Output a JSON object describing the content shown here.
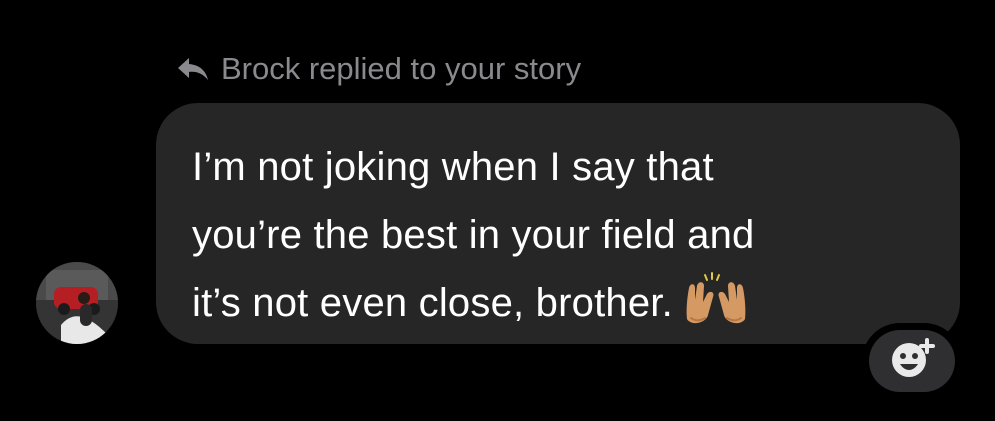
{
  "reply_context": {
    "icon": "reply-arrow-icon",
    "text": "Brock replied to your story"
  },
  "message": {
    "lines": [
      "I’m not joking when I say that",
      "you’re the best in your field and",
      "it’s not even close, brother."
    ],
    "emoji": "raised-hands-emoji"
  },
  "sender": {
    "avatar_icon": "profile-photo"
  },
  "reaction_button": {
    "icon": "add-reaction-icon"
  },
  "colors": {
    "background": "#000000",
    "bubble": "#262626",
    "text": "#ffffff",
    "muted_text": "#8a8a8e",
    "reaction_button": "#2f2f31"
  }
}
